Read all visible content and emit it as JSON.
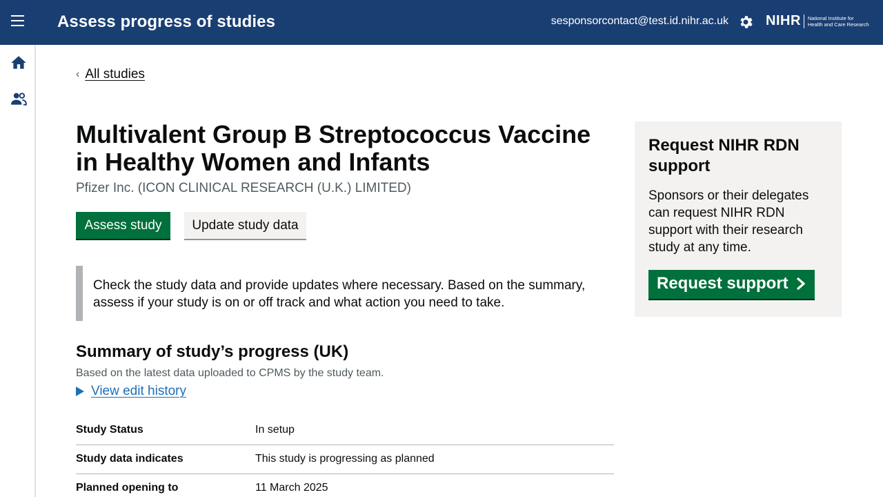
{
  "header": {
    "title": "Assess progress of studies",
    "email": "sesponsorcontact@test.id.nihr.ac.uk",
    "logo_mark": "NIHR",
    "logo_text_line1": "National Institute for",
    "logo_text_line2": "Health and Care Research"
  },
  "back_link": "All studies",
  "study": {
    "title": "Multivalent Group B Streptococcus Vaccine in Healthy Women and Infants",
    "sponsor": "Pfizer Inc. (ICON CLINICAL RESEARCH (U.K.) LIMITED)"
  },
  "buttons": {
    "assess": "Assess study",
    "update": "Update study data"
  },
  "inset_text": "Check the study data and provide updates where necessary. Based on the summary, assess if your study is on or off track and what action you need to take.",
  "summary": {
    "heading": "Summary of study’s progress (UK)",
    "subtext": "Based on the latest data uploaded to CPMS by the study team.",
    "details_link": "View edit history",
    "rows": [
      {
        "key": "Study Status",
        "value": "In setup"
      },
      {
        "key": "Study data indicates",
        "value": "This study is progressing as planned"
      },
      {
        "key": "Planned opening to",
        "value": "11 March 2025"
      }
    ]
  },
  "aside": {
    "heading": "Request NIHR RDN support",
    "body": "Sponsors or their delegates can request NIHR RDN support with their research study at any time.",
    "button": "Request support"
  },
  "icons": {
    "menu": "menu-icon",
    "settings": "gear-icon",
    "home": "home-icon",
    "people": "people-icon"
  },
  "colors": {
    "header_bg": "#193e72",
    "primary_green": "#00703c",
    "link_blue": "#1d70b8"
  }
}
